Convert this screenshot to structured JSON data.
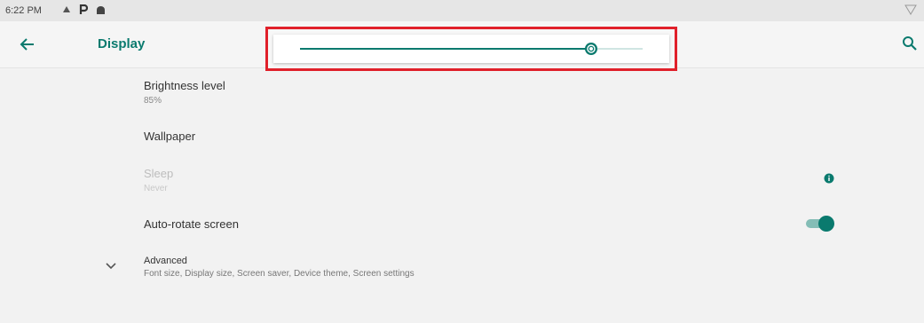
{
  "status_bar": {
    "time": "6:22 PM",
    "icons": [
      "notification-icon",
      "p-icon",
      "android-icon"
    ],
    "right_icon": "wifi-icon"
  },
  "app_bar": {
    "title": "Display",
    "back_icon": "arrow-left-icon",
    "search_icon": "search-icon"
  },
  "brightness_slider": {
    "level_fraction": 0.85,
    "thumb_icon": "brightness-icon",
    "accent_color": "#0a7a6e",
    "track_color": "#cfe5e2",
    "highlight_color": "#e0202a"
  },
  "settings": {
    "brightness": {
      "title": "Brightness level",
      "summary": "85%"
    },
    "wallpaper": {
      "title": "Wallpaper"
    },
    "sleep": {
      "title": "Sleep",
      "summary": "Never",
      "enabled": false,
      "info_icon": "info-icon"
    },
    "auto_rotate": {
      "title": "Auto-rotate screen",
      "toggle_on": true
    },
    "advanced": {
      "title": "Advanced",
      "summary": "Font size, Display size, Screen saver, Device theme, Screen settings",
      "icon": "chevron-down-icon"
    }
  }
}
